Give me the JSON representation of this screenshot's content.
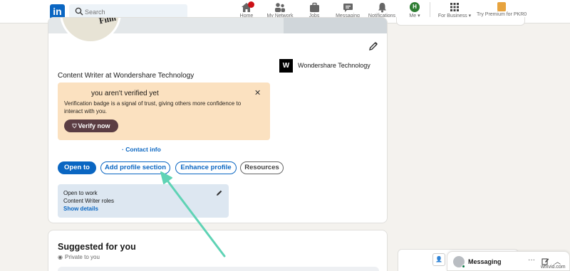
{
  "nav": {
    "search_placeholder": "Search",
    "items": [
      {
        "label": "Home",
        "icon": "home-icon"
      },
      {
        "label": "My Network",
        "icon": "network-icon"
      },
      {
        "label": "Jobs",
        "icon": "briefcase-icon"
      },
      {
        "label": "Messaging",
        "icon": "messaging-icon"
      },
      {
        "label": "Notifications",
        "icon": "bell-icon"
      },
      {
        "label": "Me",
        "icon": "avatar"
      },
      {
        "label": "For Business",
        "icon": "grid-icon"
      },
      {
        "label": "Try Premium for PKR0",
        "icon": "premium-icon"
      }
    ],
    "home_badge": "",
    "me_initial": "H"
  },
  "profile": {
    "photo_text": "Film",
    "company": "Wondershare Technology",
    "company_logo": "W",
    "headline": "Content Writer at Wondershare Technology"
  },
  "verify": {
    "title": "you aren't verified yet",
    "description": "Verification badge is a signal of trust, giving others more confidence to interact with you.",
    "button": "Verify now",
    "close": "✕"
  },
  "contact_info": "Contact info",
  "actions": {
    "open_to": "Open to",
    "add_section": "Add profile section",
    "enhance": "Enhance profile",
    "resources": "Resources"
  },
  "open_to_work": {
    "title": "Open to work",
    "roles": "Content Writer roles",
    "link": "Show details"
  },
  "suggested": {
    "title": "Suggested for you",
    "private": "Private to you"
  },
  "messaging": {
    "label": "Messaging",
    "more": "···"
  },
  "watermark": "wfxvid.com",
  "colors": {
    "accent": "#0a66c2",
    "verify_bg": "#fbe1c0",
    "verify_button": "#5b3d43",
    "open_to_work_bg": "#dde7f1",
    "arrow": "#5fd3b5"
  }
}
